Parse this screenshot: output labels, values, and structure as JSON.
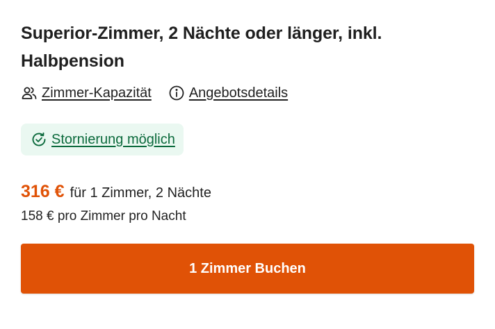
{
  "offer": {
    "title": "Superior-Zimmer, 2 Nächte oder länger, inkl. Halbpension"
  },
  "links": {
    "capacity": {
      "label": "Zimmer-Kapazität",
      "icon": "users-icon"
    },
    "details": {
      "label": "Angebotsdetails",
      "icon": "info-icon"
    }
  },
  "cancellation": {
    "label": "Stornierung möglich",
    "icon": "refresh-check-icon",
    "color": "#0b6a3c",
    "background": "#eaf8f1"
  },
  "price": {
    "total": "316 €",
    "total_desc": "für 1 Zimmer, 2 Nächte",
    "per_night": "158 € pro Zimmer pro Nacht",
    "color": "#e05206"
  },
  "book_button": {
    "label": "1 Zimmer Buchen",
    "color": "#e05206"
  }
}
